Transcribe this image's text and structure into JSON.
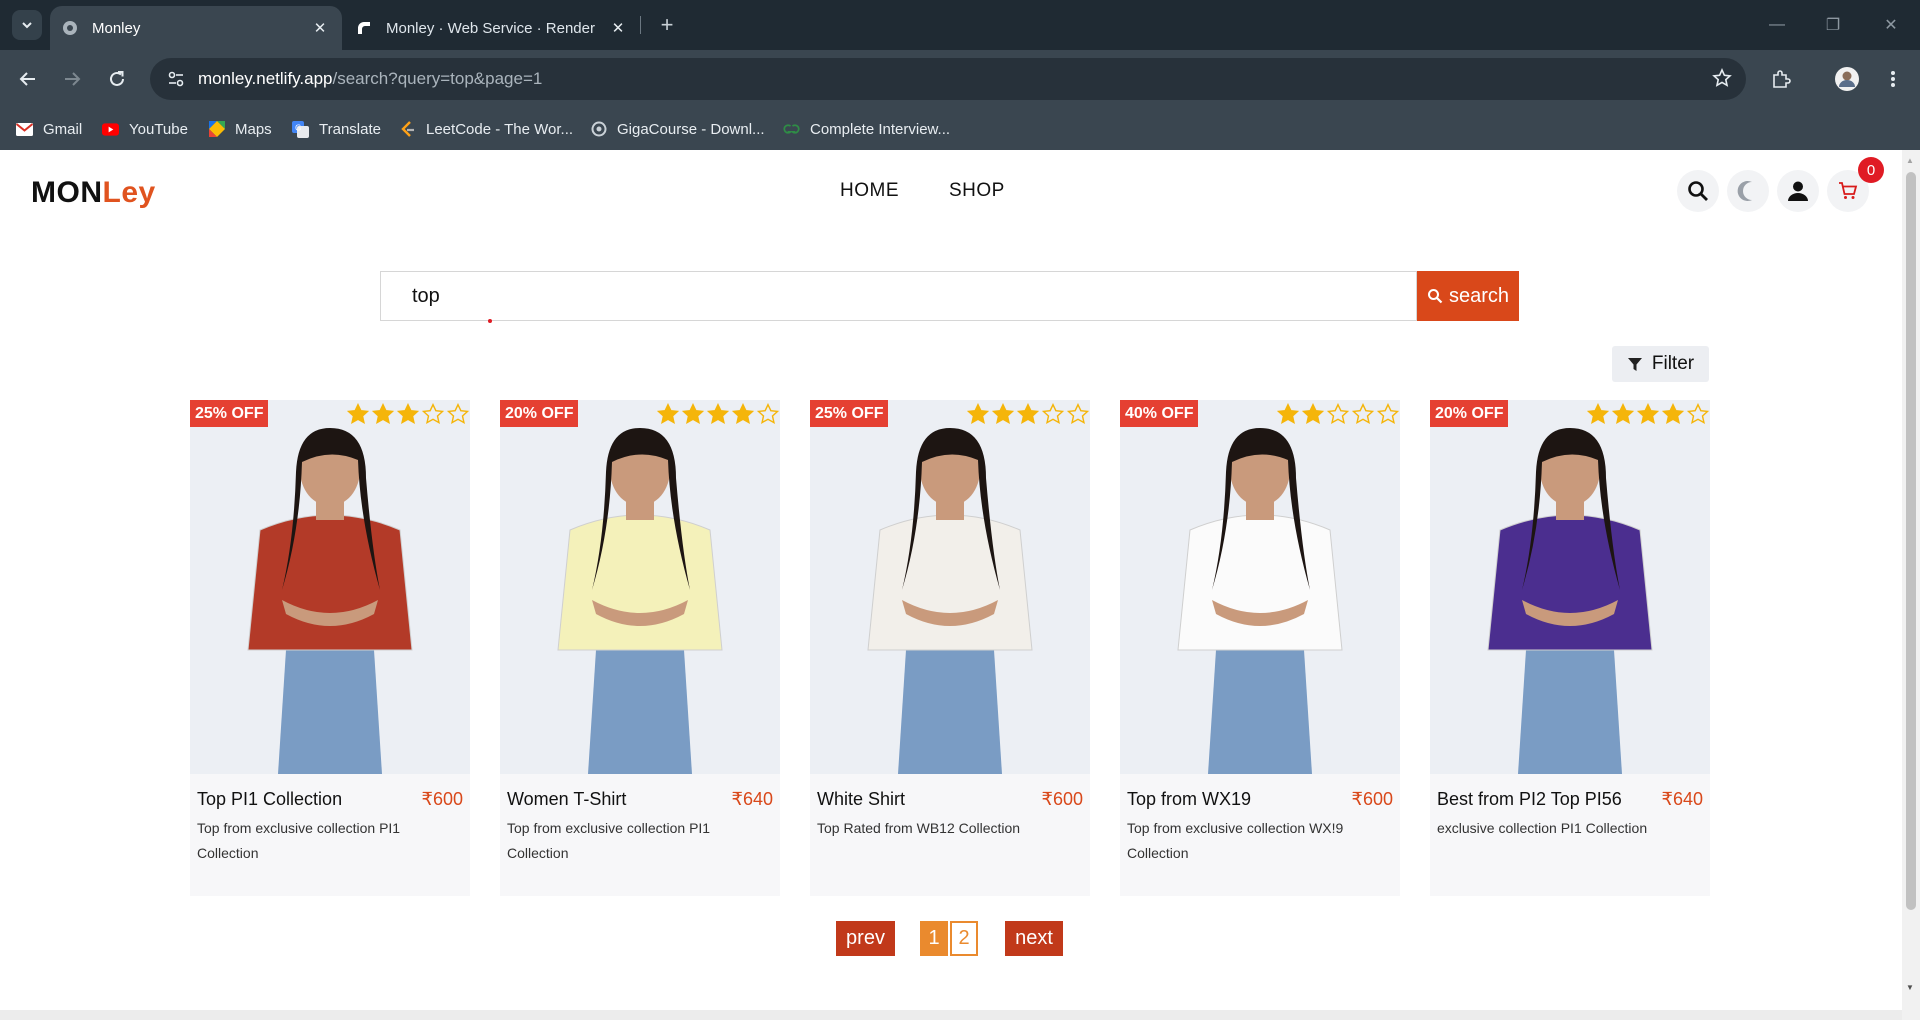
{
  "browser": {
    "tabs": [
      {
        "title": "Monley",
        "active": true
      },
      {
        "title": "Monley · Web Service · Render",
        "active": false
      }
    ],
    "url": {
      "host": "monley.netlify.app",
      "path": "/search?query=top&page=1"
    },
    "bookmarks": [
      {
        "label": "Gmail",
        "icon": "gmail-icon"
      },
      {
        "label": "YouTube",
        "icon": "youtube-icon"
      },
      {
        "label": "Maps",
        "icon": "maps-icon"
      },
      {
        "label": "Translate",
        "icon": "translate-icon"
      },
      {
        "label": "LeetCode - The Wor...",
        "icon": "leetcode-icon"
      },
      {
        "label": "GigaCourse - Downl...",
        "icon": "gigacourse-icon"
      },
      {
        "label": "Complete Interview...",
        "icon": "geeksforgeeks-icon"
      }
    ]
  },
  "header": {
    "logo_part1": "MON",
    "logo_part2": "Ley",
    "nav": [
      "HOME",
      "SHOP"
    ],
    "cart_count": "0"
  },
  "search": {
    "value": "top",
    "button_label": "search"
  },
  "filter_label": "Filter",
  "products": [
    {
      "discount": "25% OFF",
      "rating": 3,
      "name": "Top PI1 Collection",
      "price": "₹600",
      "description": "Top from exclusive collection PI1 Collection",
      "shirt_color": "#b33a28"
    },
    {
      "discount": "20% OFF",
      "rating": 4,
      "name": "Women T-Shirt",
      "price": "₹640",
      "description": "Top from exclusive collection PI1 Collection",
      "shirt_color": "#f4f1ba"
    },
    {
      "discount": "25% OFF",
      "rating": 3,
      "name": "White Shirt",
      "price": "₹600",
      "description": "Top Rated from WB12 Collection",
      "shirt_color": "#f2efea"
    },
    {
      "discount": "40% OFF",
      "rating": 2,
      "name": "Top from WX19",
      "price": "₹600",
      "description": "Top from exclusive collection WX!9 Collection",
      "shirt_color": "#fbfbfb"
    },
    {
      "discount": "20% OFF",
      "rating": 4,
      "name": "Best from PI2 Top PI56",
      "price": "₹640",
      "description": "exclusive collection PI1 Collection",
      "shirt_color": "#4b2e8f"
    }
  ],
  "pagination": {
    "prev_label": "prev",
    "next_label": "next",
    "pages": [
      "1",
      "2"
    ],
    "current_page": "1"
  },
  "colors": {
    "accent": "#d9481a",
    "logo_accent": "#e0531f",
    "badge": "#e54032",
    "star": "#f5b50a",
    "page_active": "#ea8a2e"
  }
}
